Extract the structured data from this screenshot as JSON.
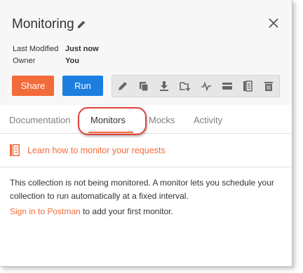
{
  "header": {
    "title": "Monitoring",
    "meta": [
      {
        "label": "Last Modified",
        "value": "Just now"
      },
      {
        "label": "Owner",
        "value": "You"
      }
    ],
    "share_label": "Share",
    "run_label": "Run",
    "toolbar_icons": [
      "pencil-icon",
      "duplicate-icon",
      "download-icon",
      "add-folder-icon",
      "monitor-pulse-icon",
      "card-icon",
      "documentation-icon",
      "trash-icon"
    ]
  },
  "tabs": [
    {
      "label": "Documentation"
    },
    {
      "label": "Monitors"
    },
    {
      "label": "Mocks"
    },
    {
      "label": "Activity"
    }
  ],
  "active_tab": "Monitors",
  "content": {
    "learn_link": "Learn how to monitor your requests",
    "description": "This collection is not being monitored. A monitor lets you schedule your collection to run automatically at a fixed interval.",
    "signin_link": "Sign in to Postman",
    "signin_suffix": " to add your first monitor."
  },
  "colors": {
    "accent": "#f26b3a",
    "run": "#1d7ee0",
    "highlight": "#e0413a"
  }
}
